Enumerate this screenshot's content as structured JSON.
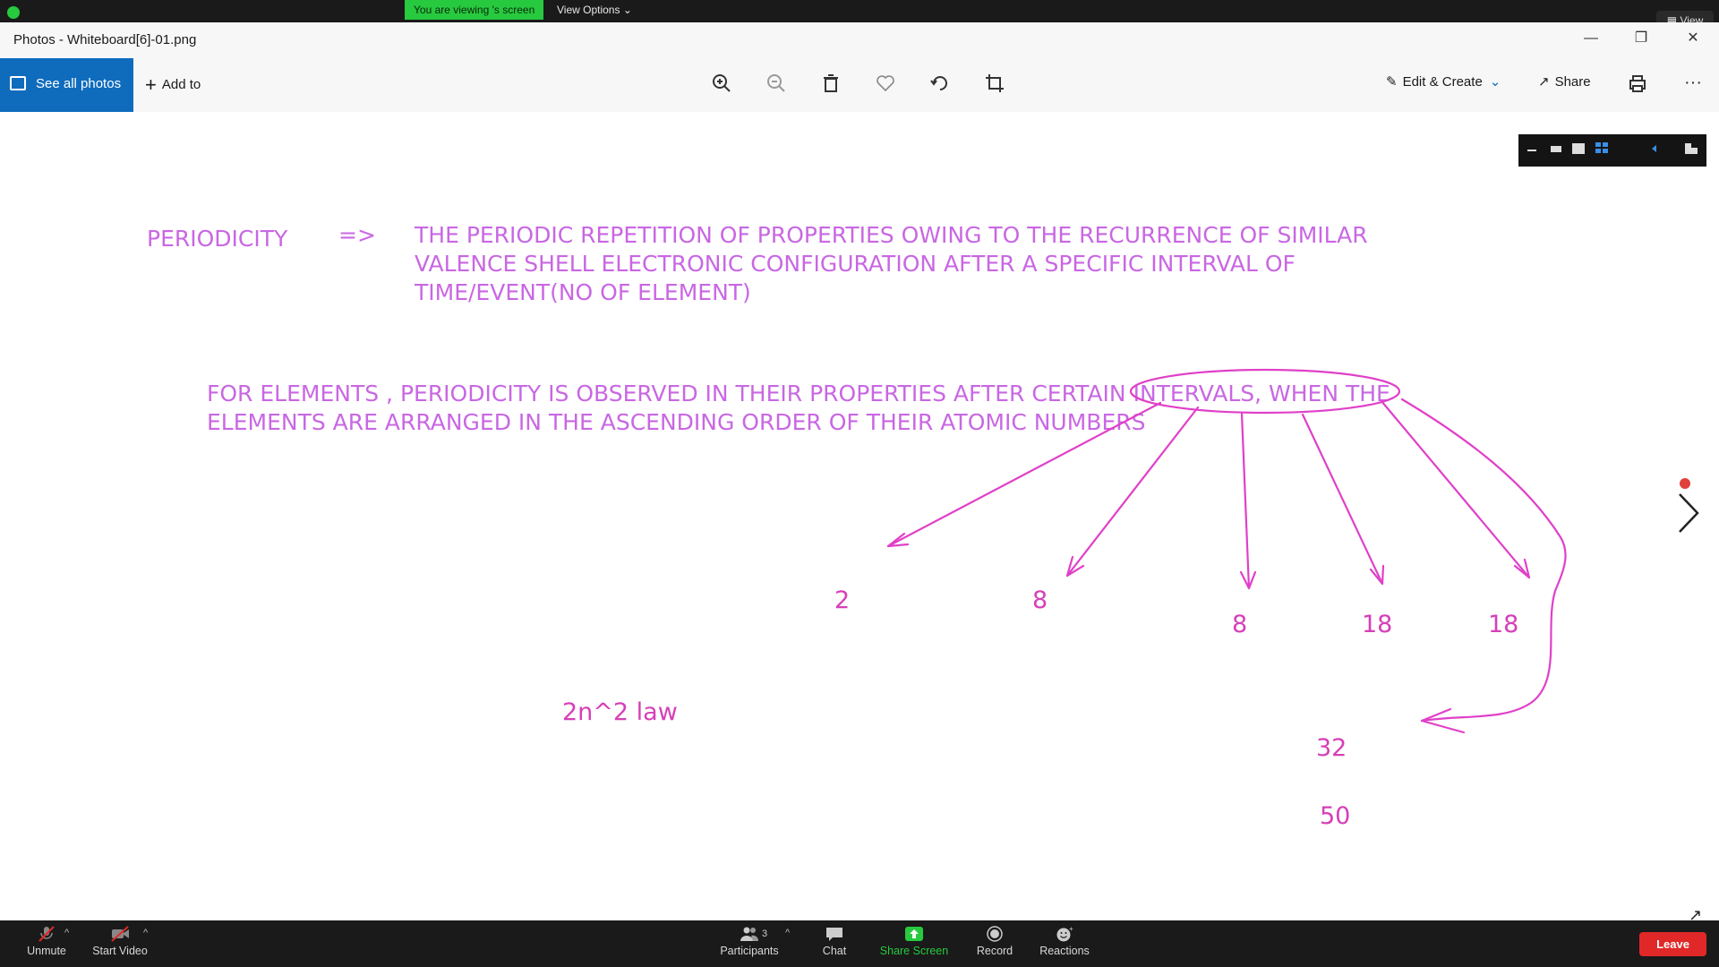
{
  "zoom_top": {
    "viewing_label": "You are viewing 's screen",
    "view_options_label": "View Options",
    "view_button_label": "View"
  },
  "window": {
    "title": "Photos - Whiteboard[6]-01.png"
  },
  "toolbar": {
    "see_all_label": "See all photos",
    "add_to_label": "Add to",
    "edit_create_label": "Edit & Create",
    "share_label": "Share",
    "more_label": "···"
  },
  "whiteboard": {
    "heading": "PERIODICITY",
    "arrow": "=>",
    "definition_lines": [
      "THE PERIODIC REPETITION OF PROPERTIES OWING TO THE RECURRENCE OF SIMILAR",
      "VALENCE SHELL ELECTRONIC CONFIGURATION AFTER A SPECIFIC INTERVAL OF",
      "TIME/EVENT(NO OF ELEMENT)"
    ],
    "statement_lines": [
      "FOR ELEMENTS , PERIODICITY IS OBSERVED IN THEIR PROPERTIES AFTER CERTAIN INTERVALS, WHEN THE",
      "ELEMENTS ARE ARRANGED IN THE ASCENDING ORDER OF THEIR ATOMIC NUMBERS"
    ],
    "numbers": [
      "2",
      "8",
      "8",
      "18",
      "18",
      "32",
      "50"
    ],
    "law_label": "2n^2   law",
    "ink_color": "#e040c8",
    "text_color": "#c967e3"
  },
  "bottom_bar": {
    "unmute_label": "Unmute",
    "start_video_label": "Start Video",
    "participants_label": "Participants",
    "participants_count": "3",
    "chat_label": "Chat",
    "share_screen_label": "Share Screen",
    "record_label": "Record",
    "reactions_label": "Reactions",
    "leave_label": "Leave"
  }
}
